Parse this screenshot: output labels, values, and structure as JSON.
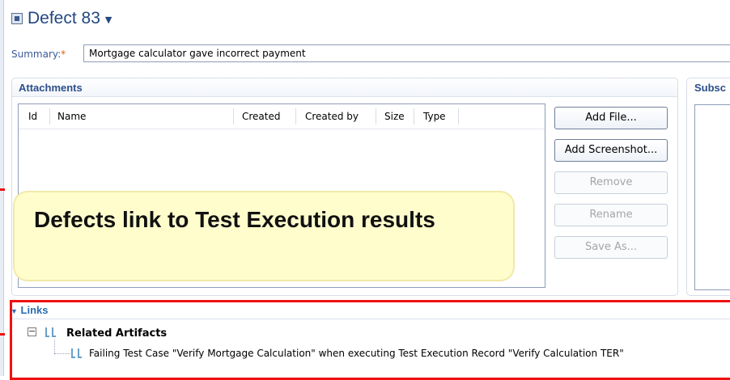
{
  "defect": {
    "title": "Defect 83",
    "caret": "▼"
  },
  "summary": {
    "label": "Summary:",
    "required_marker": "*",
    "value": "Mortgage calculator gave incorrect payment"
  },
  "attachments": {
    "title": "Attachments",
    "columns": [
      "Id",
      "Name",
      "Created",
      "Created by",
      "Size",
      "Type"
    ],
    "rows": [],
    "buttons": {
      "add_file": "Add File...",
      "add_screenshot": "Add Screenshot...",
      "remove": "Remove",
      "rename": "Rename",
      "save_as": "Save As..."
    }
  },
  "subscribers": {
    "title": "Subsc"
  },
  "callout": {
    "text": "Defects link to Test Execution results"
  },
  "links": {
    "title": "Links",
    "toggle": "▼",
    "group_label": "Related Artifacts",
    "items": [
      "Failing Test Case \"Verify Mortgage Calculation\" when executing Test Execution Record \"Verify Calculation TER\""
    ]
  },
  "colors": {
    "title_blue": "#23477f",
    "section_header_blue": "#2b4f8a",
    "highlight_red": "#ee1111",
    "callout_yellow": "#fffdcc"
  }
}
